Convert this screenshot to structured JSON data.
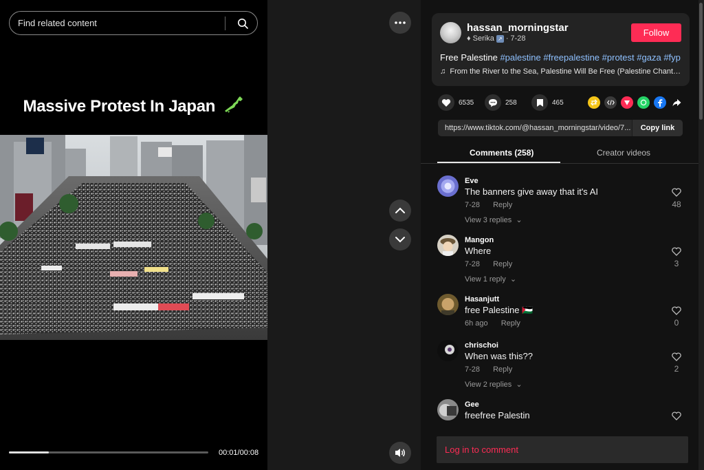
{
  "search": {
    "placeholder": "Find related content"
  },
  "video": {
    "title": "Massive Protest In Japan",
    "current_time": "00:01",
    "duration": "00:08",
    "time_label": "00:01/00:08",
    "progress": 0.2
  },
  "author": {
    "username": "hassan_morningstar",
    "nickname": "♦ Serika",
    "date": "7-28",
    "follow_label": "Follow"
  },
  "post": {
    "description_text": "Free Palestine",
    "hashtags": [
      "#palestine",
      "#freepalestine",
      "#protest",
      "#gaza",
      "#fyp"
    ],
    "music": "From the River to the Sea, Palestine Will Be Free (Palestine Chant) - hassan_morningstar"
  },
  "stats": {
    "likes": "6535",
    "comments": "258",
    "saves": "465"
  },
  "share_icons": [
    "repost-icon",
    "embed-icon",
    "send-icon",
    "whatsapp-icon",
    "facebook-icon",
    "share-arrow-icon"
  ],
  "link": {
    "url": "https://www.tiktok.com/@hassan_morningstar/video/7...",
    "copy_label": "Copy link"
  },
  "tabs": {
    "comments": "Comments (258)",
    "creator": "Creator videos"
  },
  "comments": [
    {
      "name": "Eve",
      "text": "The banners give away that it's AI",
      "date": "7-28",
      "reply": "Reply",
      "replies": "View 3 replies",
      "likes": "48"
    },
    {
      "name": "Mangon",
      "text": "Where",
      "date": "7-28",
      "reply": "Reply",
      "replies": "View 1 reply",
      "likes": "3"
    },
    {
      "name": "Hasanjutt",
      "text": "free Palestine 🇵🇸",
      "date": "6h ago",
      "reply": "Reply",
      "replies": "",
      "likes": "0"
    },
    {
      "name": "chrischoi",
      "text": "When was this??",
      "date": "7-28",
      "reply": "Reply",
      "replies": "View 2 replies",
      "likes": "2"
    },
    {
      "name": "Gee",
      "text": "freefree Palestin",
      "date": "",
      "reply": "",
      "replies": "",
      "likes": ""
    }
  ],
  "login": {
    "label": "Log in to comment"
  },
  "colors": {
    "accent": "#fe2c55",
    "hashtag": "#8fc1ff",
    "panel": "#232323",
    "background": "#121212"
  }
}
